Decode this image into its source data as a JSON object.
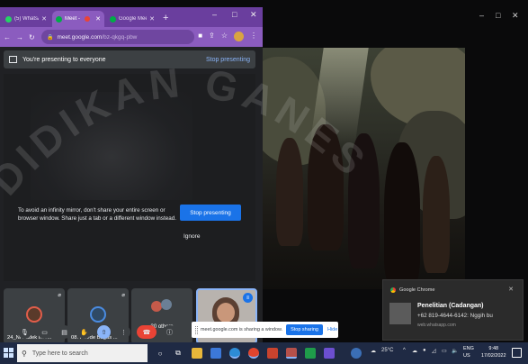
{
  "browser": {
    "tabs": [
      {
        "label": "(5) WhatsApp",
        "active": false
      },
      {
        "label": "Meet - ",
        "active": true
      },
      {
        "label": "Google Meet",
        "active": false
      }
    ],
    "new_tab": "+",
    "window_controls": [
      "–",
      "□",
      "✕"
    ],
    "url_host": "meet.google.com",
    "url_path": "/bz-qkgq-pbw",
    "colors": {
      "frame": "#6a3e9e",
      "toolbar": "#8b5cbf"
    }
  },
  "meet": {
    "presenting_text": "You're presenting to everyone",
    "stop_presenting_link": "Stop presenting",
    "warning_text": "To avoid an infinity mirror, don't share your entire screen or browser window. Share just a tab or a different window instead.",
    "stop_presenting_button": "Stop presenting",
    "ignore_label": "Ignore",
    "participants": [
      {
        "name": "24_Ni Kadek Inte...",
        "muted": true
      },
      {
        "name": "08. I Gede Bagus ...",
        "muted": true
      },
      {
        "name": "30 others",
        "muted": false
      },
      {
        "name": "You",
        "muted": false
      }
    ],
    "meeting_code_fragment": "t",
    "overflow_count": "04"
  },
  "share_notification": {
    "text": "meet.google.com is sharing a window.",
    "stop_sharing": "Stop sharing",
    "hide": "Hide"
  },
  "desktop_window_controls": [
    "–",
    "□",
    "✕"
  ],
  "toast": {
    "app": "Google Chrome",
    "title": "Penelitian (Cadangan)",
    "body": "+62 819-4644-6142: Nggih bu",
    "source": "web.whatsapp.com",
    "close": "✕"
  },
  "taskbar": {
    "search_placeholder": "Type here to search",
    "temperature": "25°C",
    "language_top": "ENG",
    "language_bottom": "US",
    "time": "9:48",
    "date": "17/02/2022",
    "colors": {
      "bar": "#1f2a44"
    }
  }
}
